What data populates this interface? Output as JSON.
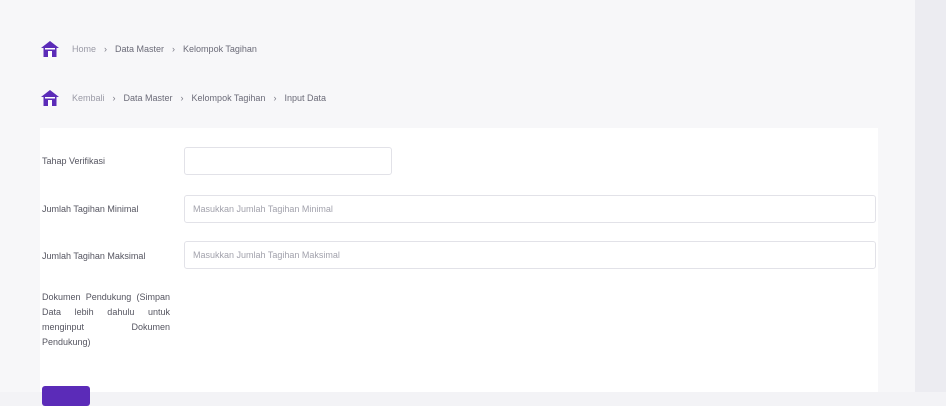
{
  "breadcrumb_top": {
    "items": [
      "Home",
      "Data Master",
      "Kelompok Tagihan"
    ]
  },
  "breadcrumb_bottom": {
    "items": [
      "Kembali",
      "Data Master",
      "Kelompok Tagihan",
      "Input Data"
    ]
  },
  "separator": "›",
  "form": {
    "tahap_verifikasi": {
      "label": "Tahap Verifikasi",
      "value": ""
    },
    "jumlah_min": {
      "label": "Jumlah Tagihan Minimal",
      "placeholder": "Masukkan Jumlah Tagihan Minimal"
    },
    "jumlah_max": {
      "label": "Jumlah Tagihan Maksimal",
      "placeholder": "Masukkan Jumlah Tagihan Maksimal"
    },
    "dokumen_note": "Dokumen Pendukung (Simpan Data lebih dahulu untuk menginput Dokumen Pendukung)"
  },
  "colors": {
    "accent": "#5b2bb8"
  },
  "icons": [
    "home-icon",
    "home-icon"
  ]
}
